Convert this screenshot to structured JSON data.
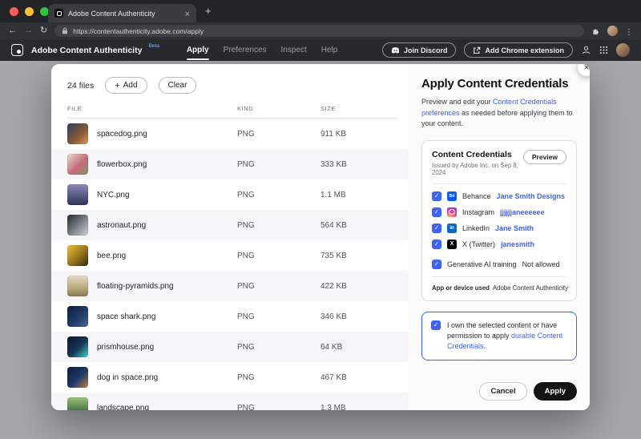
{
  "browser": {
    "tab_title": "Adobe Content Authenticity",
    "url": "https://contentauthenticity.adobe.com/apply"
  },
  "header": {
    "brand": "Adobe Content Authenticity",
    "beta_badge": "Beta",
    "nav": [
      {
        "label": "Apply",
        "active": true
      },
      {
        "label": "Preferences",
        "active": false
      },
      {
        "label": "Inspect",
        "active": false
      },
      {
        "label": "Help",
        "active": false
      }
    ],
    "actions": {
      "join_discord": "Join Discord",
      "add_extension": "Add Chrome extension"
    }
  },
  "files_panel": {
    "count_label": "24 files",
    "add_label": "Add",
    "clear_label": "Clear",
    "columns": [
      "FILE",
      "KIND",
      "SIZE"
    ],
    "rows": [
      {
        "name": "spacedog.png",
        "kind": "PNG",
        "size": "911 KB"
      },
      {
        "name": "flowerbox.png",
        "kind": "PNG",
        "size": "333 KB"
      },
      {
        "name": "NYC.png",
        "kind": "PNG",
        "size": "1.1 MB"
      },
      {
        "name": "astronaut.png",
        "kind": "PNG",
        "size": "564 KB"
      },
      {
        "name": "bee.png",
        "kind": "PNG",
        "size": "735 KB"
      },
      {
        "name": "floating-pyramids.png",
        "kind": "PNG",
        "size": "422 KB"
      },
      {
        "name": "space shark.png",
        "kind": "PNG",
        "size": "346 KB"
      },
      {
        "name": "prismhouse.png",
        "kind": "PNG",
        "size": "64 KB"
      },
      {
        "name": "dog in space.png",
        "kind": "PNG",
        "size": "467 KB"
      },
      {
        "name": "landscape.png",
        "kind": "PNG",
        "size": "1.3 MB"
      }
    ]
  },
  "apply_panel": {
    "title": "Apply Content Credentials",
    "intro_before": "Preview and edit your ",
    "intro_link": "Content Credentials preferences",
    "intro_after": " as needed before applying them to your content.",
    "credentials_card": {
      "title": "Content Credentials",
      "preview_label": "Preview",
      "issued": "Issued by Adobe Inc. on Sep 8, 2024",
      "accounts": [
        {
          "platform": "Behance",
          "value": "Jane Smith Designs",
          "icon": "behance-icon"
        },
        {
          "platform": "Instagram",
          "value": "jjjjjjaneeeeee",
          "icon": "instagram-icon"
        },
        {
          "platform": "LinkedIn",
          "value": "Jane Smith",
          "icon": "linkedin-icon"
        },
        {
          "platform": "X (Twitter)",
          "value": "janesmith",
          "icon": "x-icon"
        }
      ],
      "ai_row": {
        "label": "Generative AI training",
        "value": "Not allowed"
      },
      "app_row": {
        "label": "App or device used",
        "value": "Adobe Content Authenticity"
      }
    },
    "consent": {
      "before": "I own the selected content or have permission to apply ",
      "link": "durable Content Credentials",
      "after": "."
    },
    "cancel_label": "Cancel",
    "apply_label": "Apply"
  },
  "theme": {
    "accent": "#3b63fb",
    "apply_button": "#141414",
    "header_bg": "#2a2b2e"
  }
}
